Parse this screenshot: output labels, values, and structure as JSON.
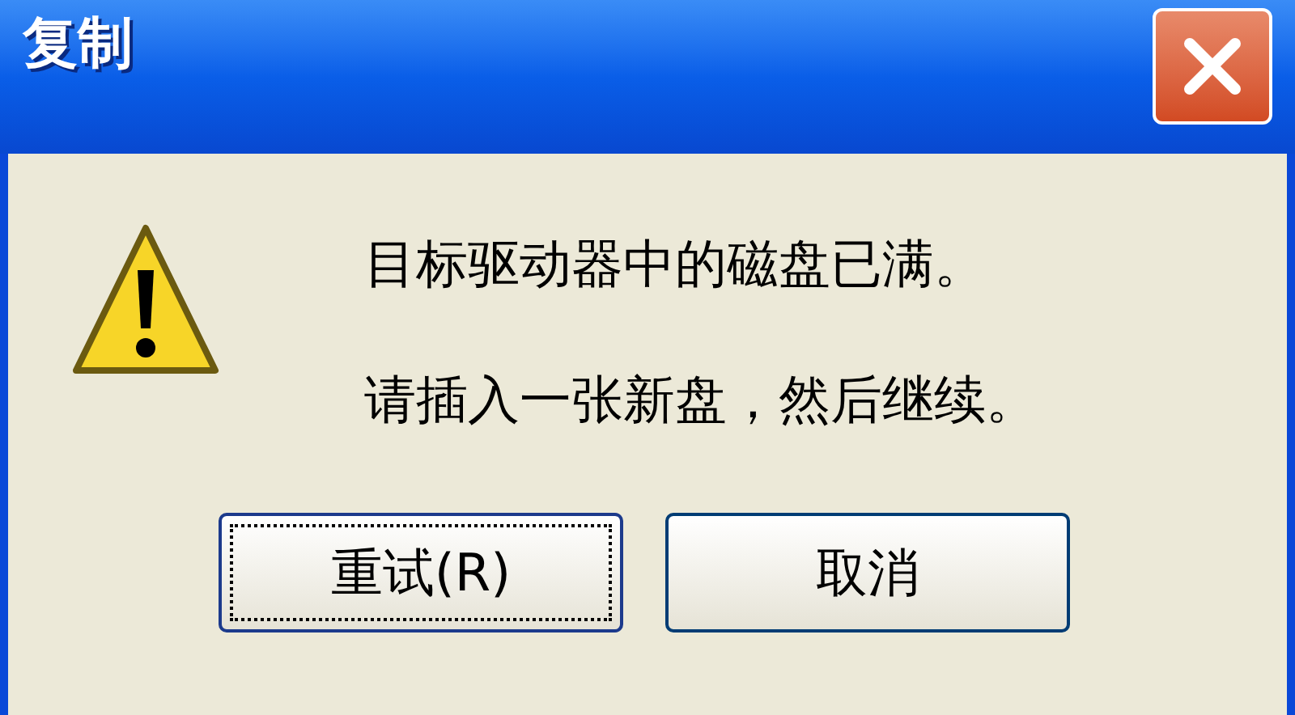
{
  "window": {
    "title": "复制"
  },
  "message": {
    "kind": "warning",
    "lines": [
      "目标驱动器中的磁盘已满。",
      "请插入一张新盘，然后继续。"
    ]
  },
  "buttons": [
    {
      "label": "重试(R)",
      "focused": true
    },
    {
      "label": "取消",
      "focused": false
    }
  ]
}
